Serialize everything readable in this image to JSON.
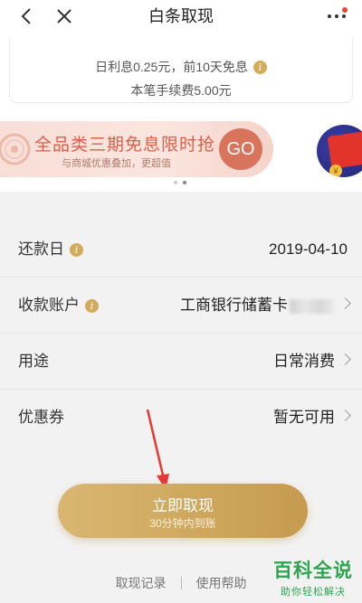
{
  "header": {
    "title": "白条取现",
    "back_icon": "chevron-left-icon",
    "close_icon": "close-icon",
    "more_icon": "more-dots-icon"
  },
  "interest": {
    "line1": "日利息0.25元，前10天免息",
    "line2": "本笔手续费5.00元",
    "info_icon": "info-icon"
  },
  "banner": {
    "title": "全品类三期免息限时抢",
    "subtitle": "与商城优惠叠加，更超值",
    "go_label": "GO",
    "pager_total": 2,
    "pager_active": 2
  },
  "form": {
    "repayment_date": {
      "label": "还款日",
      "value": "2019-04-10"
    },
    "account": {
      "label": "收款账户",
      "value": "工商银行储蓄卡"
    },
    "purpose": {
      "label": "用途",
      "value": "日常消费"
    },
    "coupon": {
      "label": "优惠券",
      "value": "暂无可用"
    }
  },
  "primary_button": {
    "label": "立即取现",
    "sub_label": "30分钟内到账"
  },
  "footer": {
    "history_link": "取现记录",
    "help_link": "使用帮助"
  },
  "watermark": {
    "main": "百科全说",
    "sub": "助你轻松解决"
  },
  "colors": {
    "accent_gold": "#cfa95f",
    "banner_text": "#d9604a",
    "annotation_red": "#e53935",
    "watermark_green": "#2ea44f"
  }
}
